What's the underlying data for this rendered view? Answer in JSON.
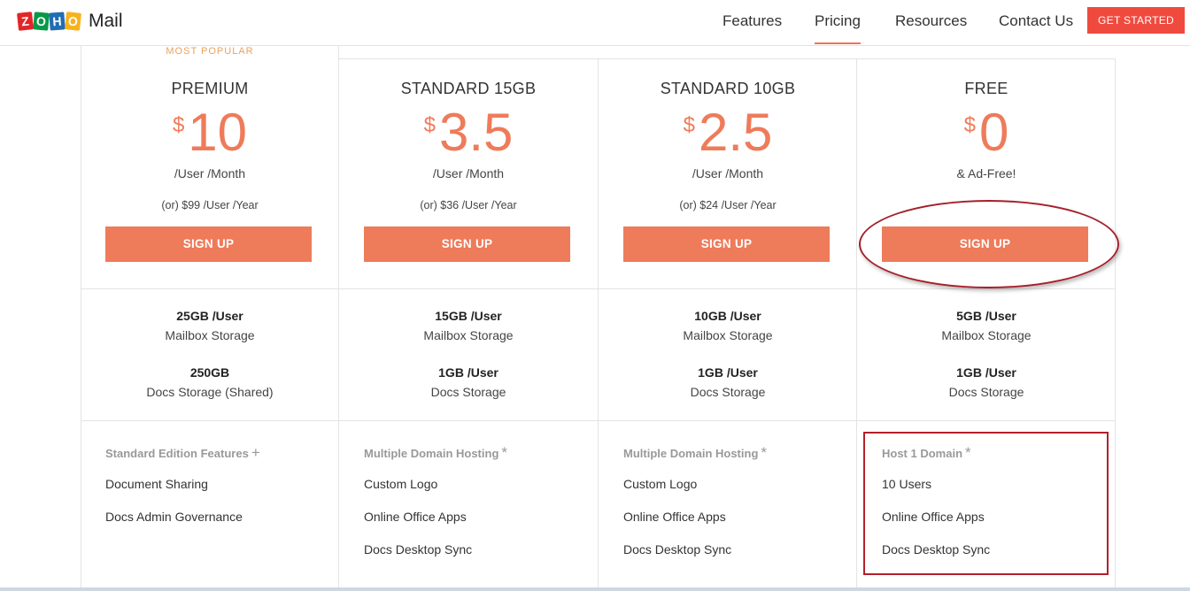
{
  "header": {
    "logo_tiles": [
      "Z",
      "O",
      "H",
      "O"
    ],
    "logo_text": "Mail",
    "nav": [
      "Features",
      "Pricing",
      "Resources",
      "Contact Us"
    ],
    "active_nav": "Pricing",
    "cta_label": "GET STARTED"
  },
  "most_popular": "MOST POPULAR",
  "plans": [
    {
      "name": "PREMIUM",
      "currency": "$",
      "price": "10",
      "per": "/User /Month",
      "yearly": "(or) $99 /User /Year",
      "signup": "SIGN UP",
      "storage1_amount": "25GB /User",
      "storage1_label": "Mailbox Storage",
      "storage2_amount": "250GB",
      "storage2_label": "Docs Storage (Shared)",
      "feature_head": "Standard Edition Features",
      "feature_head_symbol": "+",
      "features": [
        "Document Sharing",
        "Docs Admin Governance"
      ]
    },
    {
      "name": "STANDARD 15GB",
      "currency": "$",
      "price": "3.5",
      "per": "/User /Month",
      "yearly": "(or) $36 /User /Year",
      "signup": "SIGN UP",
      "storage1_amount": "15GB /User",
      "storage1_label": "Mailbox Storage",
      "storage2_amount": "1GB /User",
      "storage2_label": "Docs Storage",
      "feature_head": "Multiple Domain Hosting",
      "feature_head_symbol": "*",
      "features": [
        "Custom Logo",
        "Online Office Apps",
        "Docs Desktop Sync"
      ]
    },
    {
      "name": "STANDARD 10GB",
      "currency": "$",
      "price": "2.5",
      "per": "/User /Month",
      "yearly": "(or) $24 /User /Year",
      "signup": "SIGN UP",
      "storage1_amount": "10GB /User",
      "storage1_label": "Mailbox Storage",
      "storage2_amount": "1GB /User",
      "storage2_label": "Docs Storage",
      "feature_head": "Multiple Domain Hosting",
      "feature_head_symbol": "*",
      "features": [
        "Custom Logo",
        "Online Office Apps",
        "Docs Desktop Sync"
      ]
    },
    {
      "name": "FREE",
      "currency": "$",
      "price": "0",
      "per": "& Ad-Free!",
      "yearly": "",
      "signup": "SIGN UP",
      "storage1_amount": "5GB /User",
      "storage1_label": "Mailbox Storage",
      "storage2_amount": "1GB /User",
      "storage2_label": "Docs Storage",
      "feature_head": "Host 1 Domain",
      "feature_head_symbol": "*",
      "features": [
        "10 Users",
        "Online Office Apps",
        "Docs Desktop Sync"
      ]
    }
  ],
  "colors": {
    "accent": "#ee7b5a",
    "cta": "#f04a3f",
    "annotation": "#a5202a",
    "popular": "#e8a25f"
  }
}
